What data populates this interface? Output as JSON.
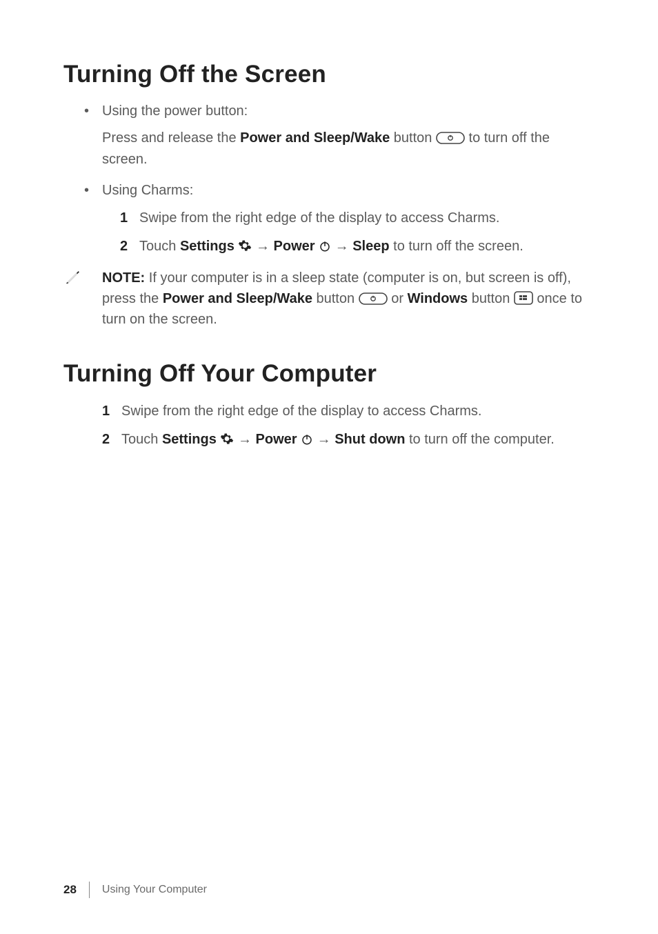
{
  "sections": [
    {
      "heading": "Turning Off the Screen",
      "bullets": [
        {
          "lead": "Using the power button:",
          "para_parts": [
            "Press and release the ",
            "Power and Sleep/Wake",
            " button ",
            "POWER_BTN_ICON",
            " to turn off the screen."
          ]
        },
        {
          "lead": "Using Charms:",
          "steps": [
            {
              "parts": [
                "Swipe from the right edge of the display to access Charms."
              ]
            },
            {
              "parts": [
                "Touch ",
                "Settings ",
                "GEAR_ICON",
                " → ",
                "Power ",
                "POWER_ICON",
                " → ",
                "Sleep",
                " to turn off the screen."
              ]
            }
          ]
        }
      ],
      "note_parts": [
        "NOTE:",
        " If your computer is in a sleep state (computer is on, but screen is off), press the ",
        "Power and Sleep/Wake",
        " button ",
        "POWER_BTN_ICON",
        " or ",
        "Windows",
        " button ",
        "WIN_BTN_ICON",
        " once to turn on the screen."
      ]
    },
    {
      "heading": "Turning Off Your Computer",
      "steps": [
        {
          "parts": [
            "Swipe from the right edge of the display to access Charms."
          ]
        },
        {
          "parts": [
            "Touch ",
            "Settings ",
            "GEAR_ICON",
            " → ",
            "Power ",
            "POWER_ICON",
            " → ",
            "Shut down",
            " to turn off the computer."
          ]
        }
      ]
    }
  ],
  "footer": {
    "page_number": "28",
    "chapter": "Using Your Computer"
  },
  "bold_tokens": [
    "Power and Sleep/Wake",
    "Settings ",
    "Power ",
    "Sleep",
    "Windows",
    "Shut down",
    "NOTE:"
  ],
  "icon_tokens": [
    "POWER_BTN_ICON",
    "GEAR_ICON",
    "POWER_ICON",
    "WIN_BTN_ICON"
  ]
}
